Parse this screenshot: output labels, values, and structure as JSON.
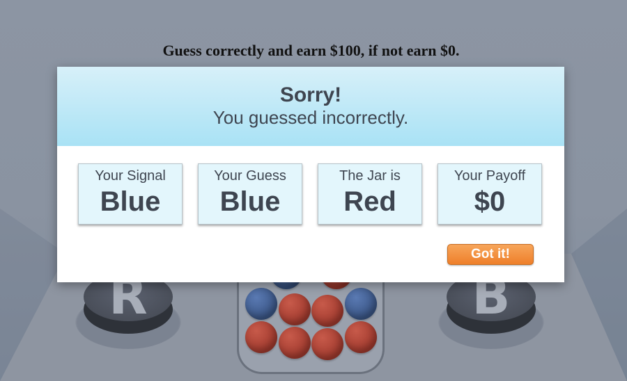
{
  "instruction": "Guess correctly and earn $100, if not earn $0.",
  "scene": {
    "button_left_letter": "R",
    "button_right_letter": "B",
    "jar_balls": [
      "blue",
      "red",
      "blue",
      "red",
      "red",
      "blue",
      "red",
      "red",
      "red",
      "red"
    ]
  },
  "modal": {
    "title": "Sorry!",
    "subtitle": "You guessed incorrectly.",
    "cards": [
      {
        "label": "Your Signal",
        "value": "Blue"
      },
      {
        "label": "Your Guess",
        "value": "Blue"
      },
      {
        "label": "The Jar is",
        "value": "Red"
      },
      {
        "label": "Your Payoff",
        "value": "$0"
      }
    ],
    "confirm_label": "Got it!"
  },
  "colors": {
    "header_gradient_top": "#d7f0f9",
    "header_gradient_bottom": "#a9e2f5",
    "card_bg": "#e3f6fc",
    "button_orange": "#ee7f2a",
    "ball_red": "#a13a2e",
    "ball_blue": "#3a5585"
  }
}
